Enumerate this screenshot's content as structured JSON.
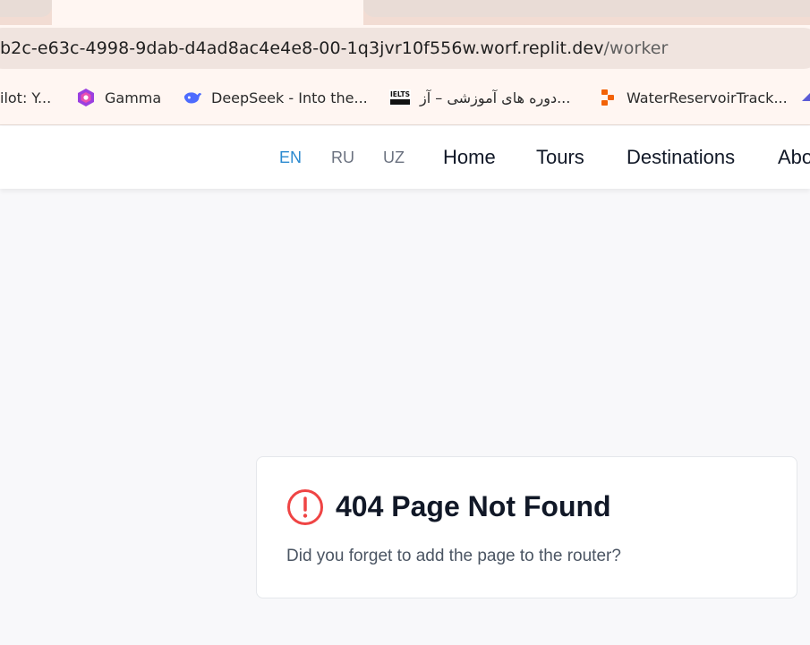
{
  "browser": {
    "url_host": "b2c-e63c-4998-9dab-d4ad8ac4e4e8-00-1q3jvr10f556w.worf.replit.dev",
    "url_path": "/worker",
    "bookmarks": [
      {
        "label": "ilot: Y...",
        "icon": "copilot-icon"
      },
      {
        "label": "Gamma",
        "icon": "gamma-icon"
      },
      {
        "label": "DeepSeek - Into the...",
        "icon": "deepseek-icon"
      },
      {
        "label": "دوره های آموزشی – آز...",
        "icon": "ielts-icon"
      },
      {
        "label": "WaterReservoirTrack...",
        "icon": "replit-icon"
      }
    ],
    "accent_color": "#2b8ad0"
  },
  "header": {
    "languages": [
      "EN",
      "RU",
      "UZ"
    ],
    "active_language": "EN",
    "nav": [
      "Home",
      "Tours",
      "Destinations",
      "Abo"
    ]
  },
  "error": {
    "title": "404 Page Not Found",
    "message": "Did you forget to add the page to the router?",
    "icon": "alert-circle-icon",
    "icon_color": "#ef4444"
  }
}
